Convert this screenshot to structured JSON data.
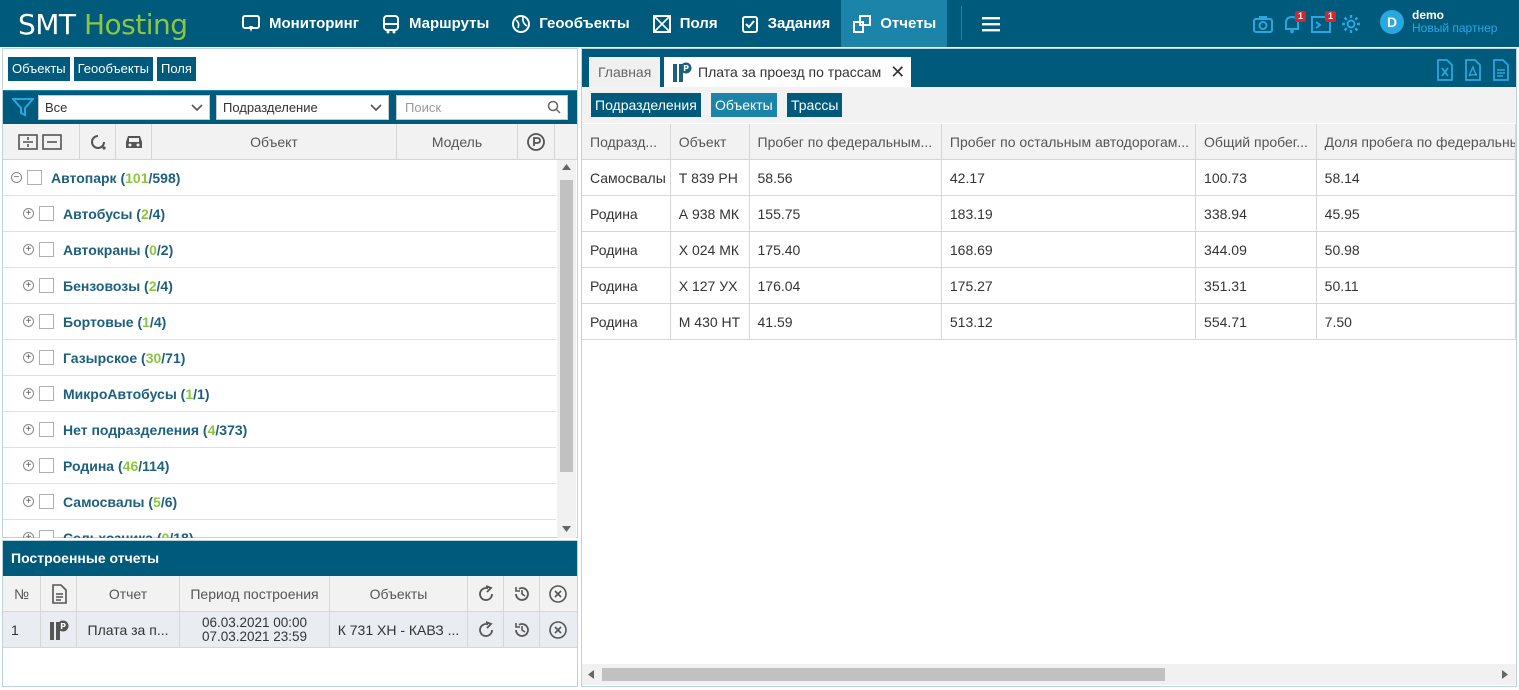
{
  "brand": {
    "part1": "SMT",
    "part2": "Hosting",
    "accent": "#8cc63f",
    "primary": "#005a7c"
  },
  "nav": [
    {
      "label": "Мониторинг",
      "icon": "monitor-icon"
    },
    {
      "label": "Маршруты",
      "icon": "bus-icon"
    },
    {
      "label": "Геообъекты",
      "icon": "globe-icon"
    },
    {
      "label": "Поля",
      "icon": "field-icon"
    },
    {
      "label": "Задания",
      "icon": "task-icon"
    },
    {
      "label": "Отчеты",
      "icon": "reports-icon",
      "active": true
    }
  ],
  "top_icons": {
    "notifications_badge": "1",
    "messages_badge": "1"
  },
  "user": {
    "initial": "D",
    "name": "demo",
    "partner": "Новый партнер"
  },
  "left": {
    "tabs": [
      "Объекты",
      "Геообъекты",
      "Поля"
    ],
    "filter_select": "Все",
    "division_select": "Подразделение",
    "search_placeholder": "Поиск",
    "columns": {
      "object": "Объект",
      "model": "Модель"
    }
  },
  "tree": [
    {
      "name": "Автопарк",
      "active": "101",
      "total": "598",
      "root": true
    },
    {
      "name": "Автобусы",
      "active": "2",
      "total": "4"
    },
    {
      "name": "Автокраны",
      "active": "0",
      "total": "2"
    },
    {
      "name": "Бензовозы",
      "active": "2",
      "total": "4"
    },
    {
      "name": "Бортовые",
      "active": "1",
      "total": "4"
    },
    {
      "name": "Газырское",
      "active": "30",
      "total": "71"
    },
    {
      "name": "МикроАвтобусы",
      "active": "1",
      "total": "1"
    },
    {
      "name": "Нет подразделения",
      "active": "4",
      "total": "373"
    },
    {
      "name": "Родина",
      "active": "46",
      "total": "114"
    },
    {
      "name": "Самосвалы",
      "active": "5",
      "total": "6"
    },
    {
      "name": "Сельхозника",
      "active": "0",
      "total": "18"
    }
  ],
  "reports": {
    "title": "Построенные отчеты",
    "columns": {
      "num": "№",
      "report": "Отчет",
      "period": "Период построения",
      "objects": "Объекты"
    },
    "rows": [
      {
        "num": "1",
        "report": "Плата за п...",
        "period_from": "06.03.2021 00:00",
        "period_to": "07.03.2021 23:59",
        "objects": "К 731 ХН - КАВЗ ..."
      }
    ]
  },
  "right": {
    "tab_home": "Главная",
    "tab_report": "Плата за проезд по трассам",
    "sub_tabs": [
      "Подразделения",
      "Объекты",
      "Трассы"
    ],
    "columns": [
      "Подразд...",
      "Объект",
      "Пробег по федеральным...",
      "Пробег по остальным автодорогам...",
      "Общий пробег...",
      "Доля пробега по федеральным"
    ],
    "rows": [
      [
        "Самосвалы",
        "Т 839 РН",
        "58.56",
        "42.17",
        "100.73",
        "58.14"
      ],
      [
        "Родина",
        "А 938 МК",
        "155.75",
        "183.19",
        "338.94",
        "45.95"
      ],
      [
        "Родина",
        "Х 024 МК",
        "175.40",
        "168.69",
        "344.09",
        "50.98"
      ],
      [
        "Родина",
        "Х 127 УХ",
        "176.04",
        "175.27",
        "351.31",
        "50.11"
      ],
      [
        "Родина",
        "М 430 НТ",
        "41.59",
        "513.12",
        "554.71",
        "7.50"
      ]
    ]
  }
}
